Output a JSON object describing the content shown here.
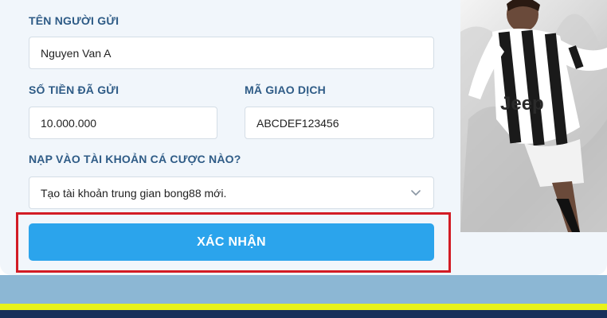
{
  "form": {
    "sender_label": "TÊN NGƯỜI GỬI",
    "sender_value": "Nguyen Van A",
    "amount_label": "SỐ TIỀN ĐÃ GỬI",
    "amount_value": "10.000.000",
    "txn_label": "MÃ GIAO DỊCH",
    "txn_value": "ABCDEF123456",
    "account_label": "NẠP VÀO TÀI KHOẢN CÁ CƯỢC NÀO?",
    "account_selected": "Tạo tài khoản trung gian bong88 mới.",
    "confirm_label": "XÁC NHẬN"
  },
  "hero": {
    "sponsor_text": "Jeep"
  },
  "colors": {
    "panel_bg": "#f1f6fb",
    "label": "#2e5b86",
    "button": "#2ba4ec",
    "highlight": "#d21c25",
    "outer_bg": "#8cb7d4",
    "yellow_strip": "#e8f21a",
    "dark_strip": "#17305a"
  },
  "icons": {
    "select_chevron": "chevron-down-icon"
  }
}
